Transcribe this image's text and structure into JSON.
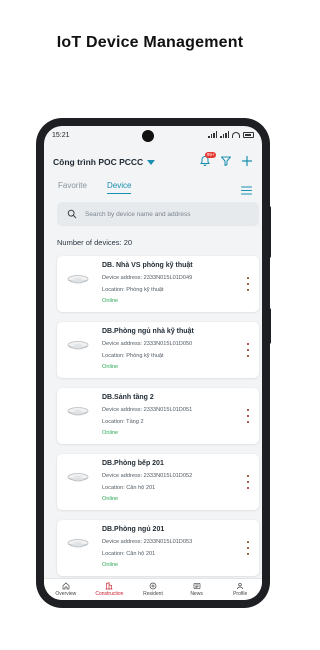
{
  "headline": "IoT Device Management",
  "status_bar": {
    "time": "15:21"
  },
  "header": {
    "project": "Công trình POC PCCC",
    "notification_badge": "99+"
  },
  "tabs": [
    {
      "label": "Favorite",
      "active": false
    },
    {
      "label": "Device",
      "active": true
    }
  ],
  "search": {
    "placeholder": "Search by device name and address",
    "value": ""
  },
  "device_count": "Number of devices: 20",
  "devices": [
    {
      "name": "DB. Nhà VS phòng kỹ thuật",
      "address": "Device address: 2333N015L01D049",
      "location": "Location: Phòng kỹ thuật",
      "status": "Online"
    },
    {
      "name": "DB.Phòng ngủ nhà kỹ thuật",
      "address": "Device address: 2333N015L01D050",
      "location": "Location: Phòng kỹ thuật",
      "status": "Online"
    },
    {
      "name": "DB.Sảnh tầng 2",
      "address": "Device address: 2333N015L01D051",
      "location": "Location: Tầng 2",
      "status": "Online"
    },
    {
      "name": "DB.Phòng bếp 201",
      "address": "Device address: 2333N015L01D052",
      "location": "Location: Căn hộ 201",
      "status": "Online"
    },
    {
      "name": "DB.Phòng ngủ 201",
      "address": "Device address: 2333N015L01D053",
      "location": "Location: Căn hộ 201",
      "status": "Online"
    }
  ],
  "bottom_nav": [
    {
      "label": "Overview",
      "icon": "home-icon",
      "active": false
    },
    {
      "label": "Construction",
      "icon": "building-icon",
      "active": true
    },
    {
      "label": "Resident",
      "icon": "resident-icon",
      "active": false
    },
    {
      "label": "News",
      "icon": "news-icon",
      "active": false
    },
    {
      "label": "Profile",
      "icon": "profile-icon",
      "active": false
    }
  ],
  "colors": {
    "accent": "#1a8fb0",
    "online": "#2eaa57",
    "active_nav": "#c8202f",
    "more_dots": "#8b2d12"
  }
}
